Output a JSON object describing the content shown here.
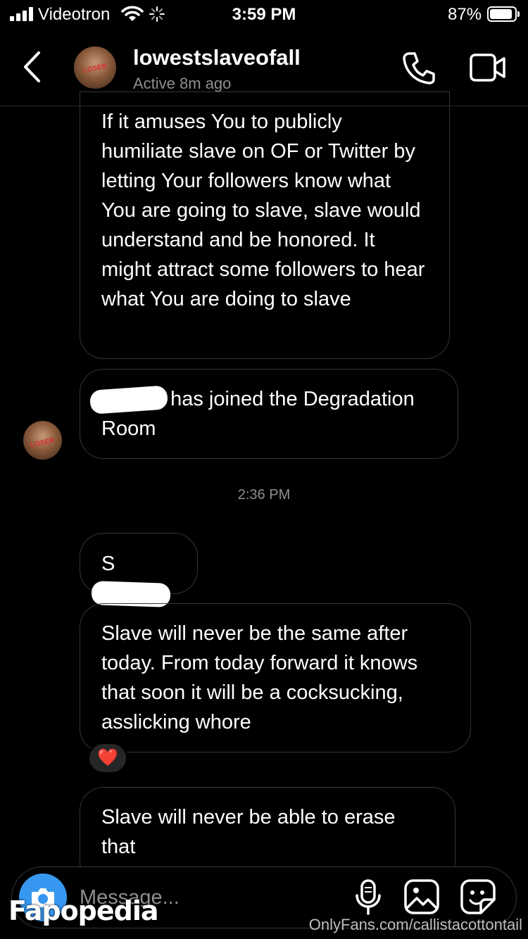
{
  "status_bar": {
    "carrier": "Videotron",
    "time": "3:59 PM",
    "battery": "87%",
    "icons": [
      "signal-bars-icon",
      "wifi-icon",
      "loading-spinner-icon",
      "battery-icon"
    ]
  },
  "header": {
    "username": "lowestslaveofall",
    "activity": "Active 8m ago",
    "icons": [
      "back-chevron-icon",
      "avatar",
      "phone-icon",
      "video-camera-icon"
    ]
  },
  "messages": [
    {
      "text": "If it amuses You to publicly humiliate slave on OF or Twitter by letting Your followers know what You are going to slave, slave would understand and be honored. It might attract some followers to hear what You are doing to slave"
    },
    {
      "text": "has joined the Degradation Room",
      "redacted_prefix": true
    },
    {
      "text": "S",
      "redacted_suffix": true
    },
    {
      "text": "Slave will never be the same after today. From today forward it knows that soon it will be a cocksucking, asslicking whore",
      "reaction": "❤️"
    },
    {
      "text": "Slave will never be able to erase that"
    }
  ],
  "timestamp": "2:36 PM",
  "composer": {
    "placeholder": "Message...",
    "icons": [
      "camera-icon",
      "microphone-icon",
      "gallery-icon",
      "sticker-icon"
    ]
  },
  "watermarks": {
    "left": "Fapopedia",
    "right": "OnlyFans.com/callistacottontail"
  },
  "colors": {
    "background": "#000000",
    "bubble_border": "#363636",
    "secondary_text": "#8e8e8e",
    "camera_button": "#3797f0",
    "heart": "#ed1c3a"
  }
}
